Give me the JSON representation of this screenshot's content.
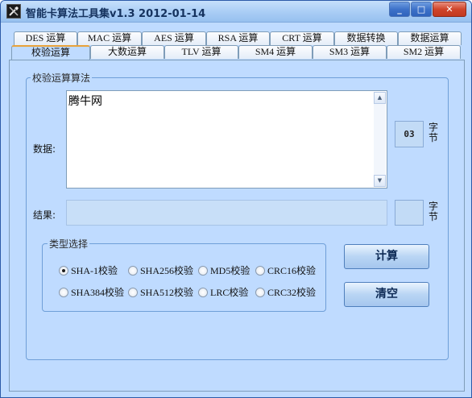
{
  "window": {
    "title": "智能卡算法工具集v1.3 2012-01-14",
    "controls": {
      "minimize": "_",
      "maximize": "□",
      "close": "✕"
    }
  },
  "tabs_back": [
    "DES 运算",
    "MAC 运算",
    "AES 运算",
    "RSA 运算",
    "CRT 运算",
    "数据转换",
    "数据运算"
  ],
  "tabs_front": [
    "校验运算",
    "大数运算",
    "TLV 运算",
    "SM4 运算",
    "SM3 运算",
    "SM2 运算"
  ],
  "active_tab": "校验运算",
  "panel": {
    "group_title": "校验运算算法",
    "data_label": "数据:",
    "data_value": "腾牛网",
    "data_length": "03",
    "data_unit": "字节",
    "result_label": "结果:",
    "result_value": "",
    "result_length": "",
    "result_unit": "字节"
  },
  "type_select": {
    "title": "类型选择",
    "options": [
      "SHA-1校验",
      "SHA256校验",
      "MD5校验",
      "CRC16校验",
      "SHA384校验",
      "SHA512校验",
      "LRC校验",
      "CRC32校验"
    ],
    "selected": "SHA-1校验"
  },
  "buttons": {
    "compute": "计算",
    "clear": "清空"
  }
}
